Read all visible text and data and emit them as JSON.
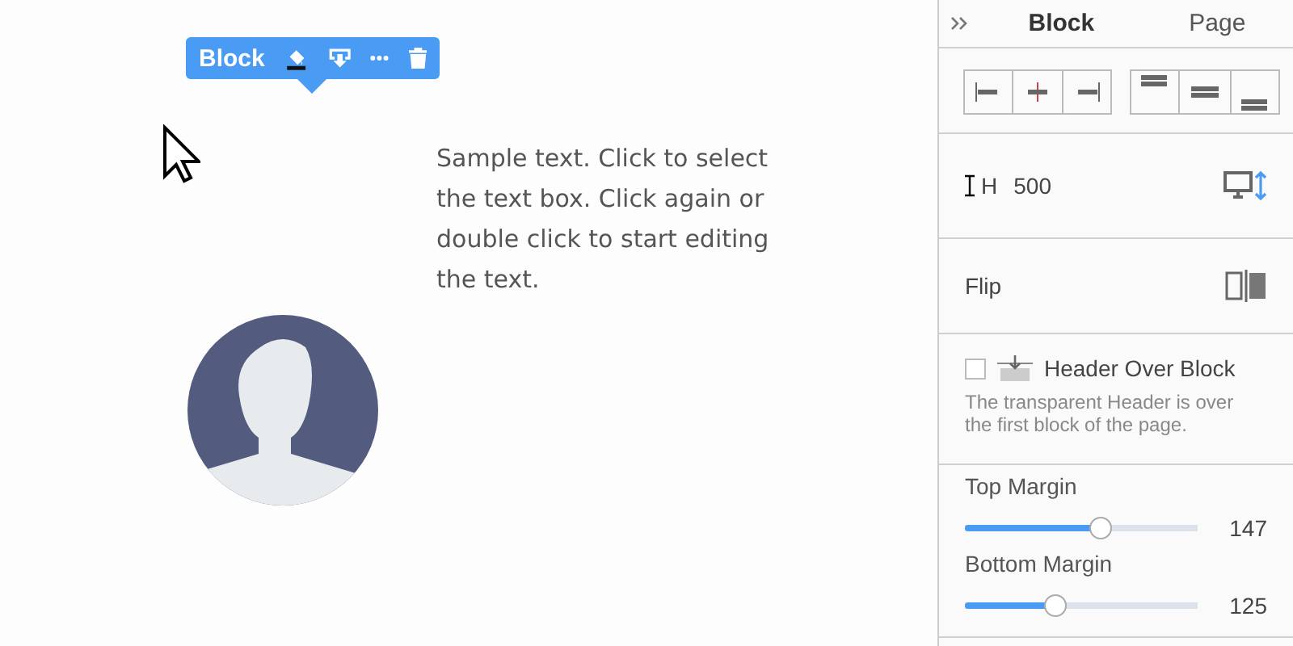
{
  "block_toolbar": {
    "label": "Block"
  },
  "sample_text": "Sample text. Click to select the text box. Click again or double click to start editing the text.",
  "panel": {
    "tabs": [
      {
        "label": "Block",
        "selected": true
      },
      {
        "label": "Page",
        "selected": false
      }
    ],
    "height": {
      "label": "H",
      "value": "500"
    },
    "flip": {
      "label": "Flip"
    },
    "header_over_block": {
      "label": "Header Over Block",
      "checked": false,
      "description": "The transparent Header is over the first block of the page."
    },
    "sliders": [
      {
        "label": "Top Margin",
        "level": 0.58,
        "reading": "147"
      },
      {
        "label": "Bottom Margin",
        "level": 0.39,
        "reading": "125"
      }
    ]
  }
}
